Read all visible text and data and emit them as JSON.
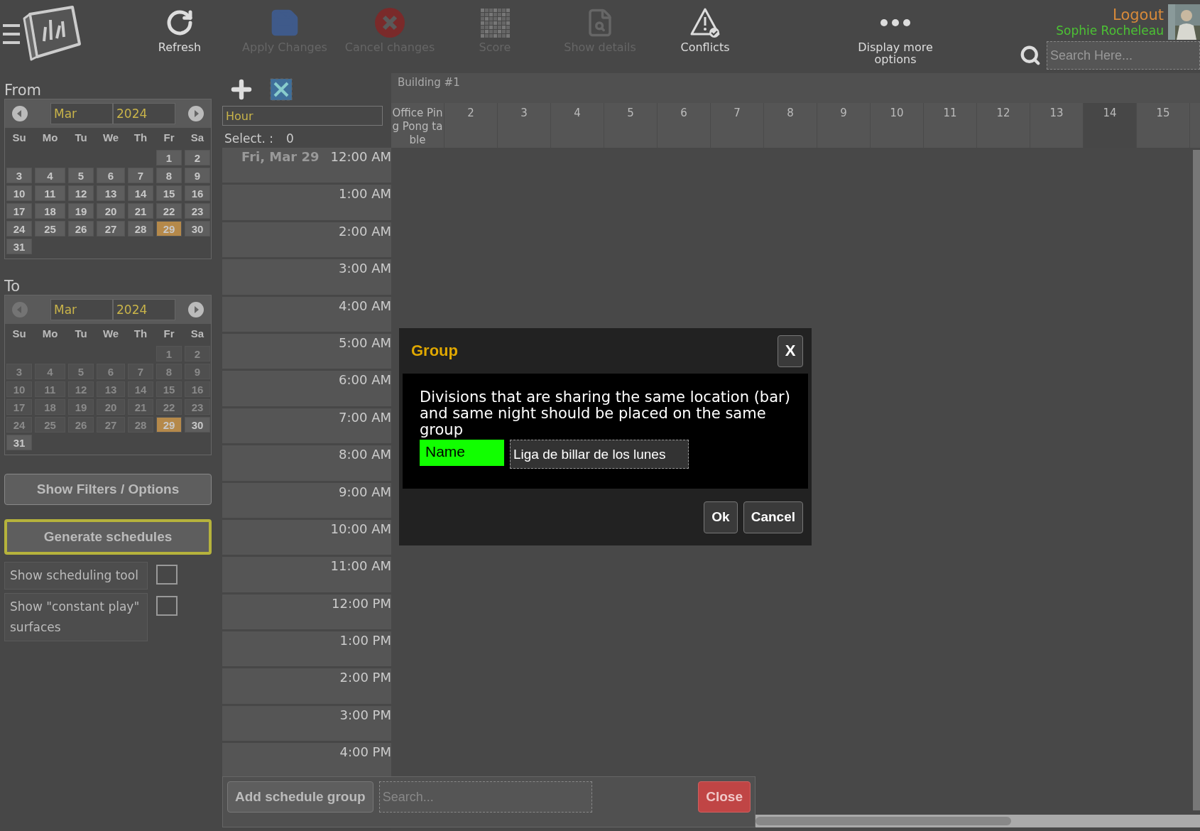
{
  "toolbar": {
    "items": [
      {
        "kind": "refresh",
        "label": "Refresh",
        "disabled": false
      },
      {
        "kind": "save",
        "label": "Apply Changes",
        "disabled": true
      },
      {
        "kind": "cancel",
        "label": "Cancel changes",
        "disabled": true
      },
      {
        "kind": "grid",
        "label": "Score",
        "disabled": true
      },
      {
        "kind": "details",
        "label": "Show details",
        "disabled": true
      },
      {
        "kind": "warning",
        "label": "Conflicts",
        "disabled": false
      },
      {
        "kind": "more",
        "label": "Display more options",
        "disabled": false
      }
    ]
  },
  "user": {
    "logout": "Logout",
    "name": "Sophie Rocheleau"
  },
  "search": {
    "placeholder": "Search Here..."
  },
  "sidebar": {
    "calendars": [
      {
        "label": "From",
        "month": "Mar",
        "year": "2024",
        "prev_disabled": false,
        "weekdays": [
          "Su",
          "Mo",
          "Tu",
          "We",
          "Th",
          "Fr",
          "Sa"
        ],
        "weeks": [
          [
            {
              "label": "1",
              "selected": false,
              "disabled": false
            },
            {
              "label": "2",
              "selected": false,
              "disabled": false
            }
          ],
          [
            {
              "label": "3",
              "selected": false,
              "disabled": false
            },
            {
              "label": "4",
              "selected": false,
              "disabled": false
            },
            {
              "label": "5",
              "selected": false,
              "disabled": false
            },
            {
              "label": "6",
              "selected": false,
              "disabled": false
            },
            {
              "label": "7",
              "selected": false,
              "disabled": false
            },
            {
              "label": "8",
              "selected": false,
              "disabled": false
            },
            {
              "label": "9",
              "selected": false,
              "disabled": false
            }
          ],
          [
            {
              "label": "10",
              "selected": false,
              "disabled": false
            },
            {
              "label": "11",
              "selected": false,
              "disabled": false
            },
            {
              "label": "12",
              "selected": false,
              "disabled": false
            },
            {
              "label": "13",
              "selected": false,
              "disabled": false
            },
            {
              "label": "14",
              "selected": false,
              "disabled": false
            },
            {
              "label": "15",
              "selected": false,
              "disabled": false
            },
            {
              "label": "16",
              "selected": false,
              "disabled": false
            }
          ],
          [
            {
              "label": "17",
              "selected": false,
              "disabled": false
            },
            {
              "label": "18",
              "selected": false,
              "disabled": false
            },
            {
              "label": "19",
              "selected": false,
              "disabled": false
            },
            {
              "label": "20",
              "selected": false,
              "disabled": false
            },
            {
              "label": "21",
              "selected": false,
              "disabled": false
            },
            {
              "label": "22",
              "selected": false,
              "disabled": false
            },
            {
              "label": "23",
              "selected": false,
              "disabled": false
            }
          ],
          [
            {
              "label": "24",
              "selected": false,
              "disabled": false
            },
            {
              "label": "25",
              "selected": false,
              "disabled": false
            },
            {
              "label": "26",
              "selected": false,
              "disabled": false
            },
            {
              "label": "27",
              "selected": false,
              "disabled": false
            },
            {
              "label": "28",
              "selected": false,
              "disabled": false
            },
            {
              "label": "29",
              "selected": true,
              "disabled": false
            },
            {
              "label": "30",
              "selected": false,
              "disabled": false
            }
          ],
          [
            {
              "label": "31",
              "selected": false,
              "disabled": false
            }
          ]
        ]
      },
      {
        "label": "To",
        "month": "Mar",
        "year": "2024",
        "prev_disabled": true,
        "weekdays": [
          "Su",
          "Mo",
          "Tu",
          "We",
          "Th",
          "Fr",
          "Sa"
        ],
        "weeks": [
          [
            {
              "label": "1",
              "selected": false,
              "disabled": true
            },
            {
              "label": "2",
              "selected": false,
              "disabled": true
            }
          ],
          [
            {
              "label": "3",
              "selected": false,
              "disabled": true
            },
            {
              "label": "4",
              "selected": false,
              "disabled": true
            },
            {
              "label": "5",
              "selected": false,
              "disabled": true
            },
            {
              "label": "6",
              "selected": false,
              "disabled": true
            },
            {
              "label": "7",
              "selected": false,
              "disabled": true
            },
            {
              "label": "8",
              "selected": false,
              "disabled": true
            },
            {
              "label": "9",
              "selected": false,
              "disabled": true
            }
          ],
          [
            {
              "label": "10",
              "selected": false,
              "disabled": true
            },
            {
              "label": "11",
              "selected": false,
              "disabled": true
            },
            {
              "label": "12",
              "selected": false,
              "disabled": true
            },
            {
              "label": "13",
              "selected": false,
              "disabled": true
            },
            {
              "label": "14",
              "selected": false,
              "disabled": true
            },
            {
              "label": "15",
              "selected": false,
              "disabled": true
            },
            {
              "label": "16",
              "selected": false,
              "disabled": true
            }
          ],
          [
            {
              "label": "17",
              "selected": false,
              "disabled": true
            },
            {
              "label": "18",
              "selected": false,
              "disabled": true
            },
            {
              "label": "19",
              "selected": false,
              "disabled": true
            },
            {
              "label": "20",
              "selected": false,
              "disabled": true
            },
            {
              "label": "21",
              "selected": false,
              "disabled": true
            },
            {
              "label": "22",
              "selected": false,
              "disabled": true
            },
            {
              "label": "23",
              "selected": false,
              "disabled": true
            }
          ],
          [
            {
              "label": "24",
              "selected": false,
              "disabled": true
            },
            {
              "label": "25",
              "selected": false,
              "disabled": true
            },
            {
              "label": "26",
              "selected": false,
              "disabled": true
            },
            {
              "label": "27",
              "selected": false,
              "disabled": true
            },
            {
              "label": "28",
              "selected": false,
              "disabled": true
            },
            {
              "label": "29",
              "selected": true,
              "disabled": false
            },
            {
              "label": "30",
              "selected": false,
              "disabled": false
            }
          ],
          [
            {
              "label": "31",
              "selected": false,
              "disabled": false
            }
          ]
        ]
      }
    ],
    "filters_button": "Show Filters / Options",
    "generate_button": "Generate schedules",
    "options": [
      {
        "label": "Show scheduling tool",
        "checked": false
      },
      {
        "label": "Show \"constant play\" surfaces",
        "checked": false
      }
    ]
  },
  "schedule": {
    "hour_field": "Hour",
    "select_label": "Select. :",
    "select_count": "0",
    "building": "Building #1",
    "columns": [
      {
        "label": "Office Ping Pong table",
        "highlighted": false
      },
      {
        "label": "2",
        "highlighted": false
      },
      {
        "label": "3",
        "highlighted": false
      },
      {
        "label": "4",
        "highlighted": false
      },
      {
        "label": "5",
        "highlighted": false
      },
      {
        "label": "6",
        "highlighted": false
      },
      {
        "label": "7",
        "highlighted": false
      },
      {
        "label": "8",
        "highlighted": false
      },
      {
        "label": "9",
        "highlighted": false
      },
      {
        "label": "10",
        "highlighted": false
      },
      {
        "label": "11",
        "highlighted": false
      },
      {
        "label": "12",
        "highlighted": false
      },
      {
        "label": "13",
        "highlighted": false
      },
      {
        "label": "14",
        "highlighted": true
      },
      {
        "label": "15",
        "highlighted": false
      }
    ],
    "rows": [
      {
        "date": "Fri, Mar 29",
        "time": "12:00 AM"
      },
      {
        "time": "1:00 AM"
      },
      {
        "time": "2:00 AM"
      },
      {
        "time": "3:00 AM"
      },
      {
        "time": "4:00 AM"
      },
      {
        "time": "5:00 AM"
      },
      {
        "time": "6:00 AM"
      },
      {
        "time": "7:00 AM"
      },
      {
        "time": "8:00 AM"
      },
      {
        "time": "9:00 AM"
      },
      {
        "time": "10:00 AM"
      },
      {
        "time": "11:00 AM"
      },
      {
        "time": "12:00 PM"
      },
      {
        "time": "1:00 PM"
      },
      {
        "time": "2:00 PM"
      },
      {
        "time": "3:00 PM"
      },
      {
        "time": "4:00 PM"
      }
    ]
  },
  "group_panel": {
    "add_button": "Add schedule group",
    "search_placeholder": "Search...",
    "close_button": "Close"
  },
  "dialog": {
    "title": "Group",
    "close": "X",
    "message": "Divisions that are sharing the same location (bar) and same night should be placed on the same group",
    "field_label": "Name",
    "field_value": "Liga de billar de los lunes",
    "buttons": [
      "Ok",
      "Cancel"
    ]
  }
}
